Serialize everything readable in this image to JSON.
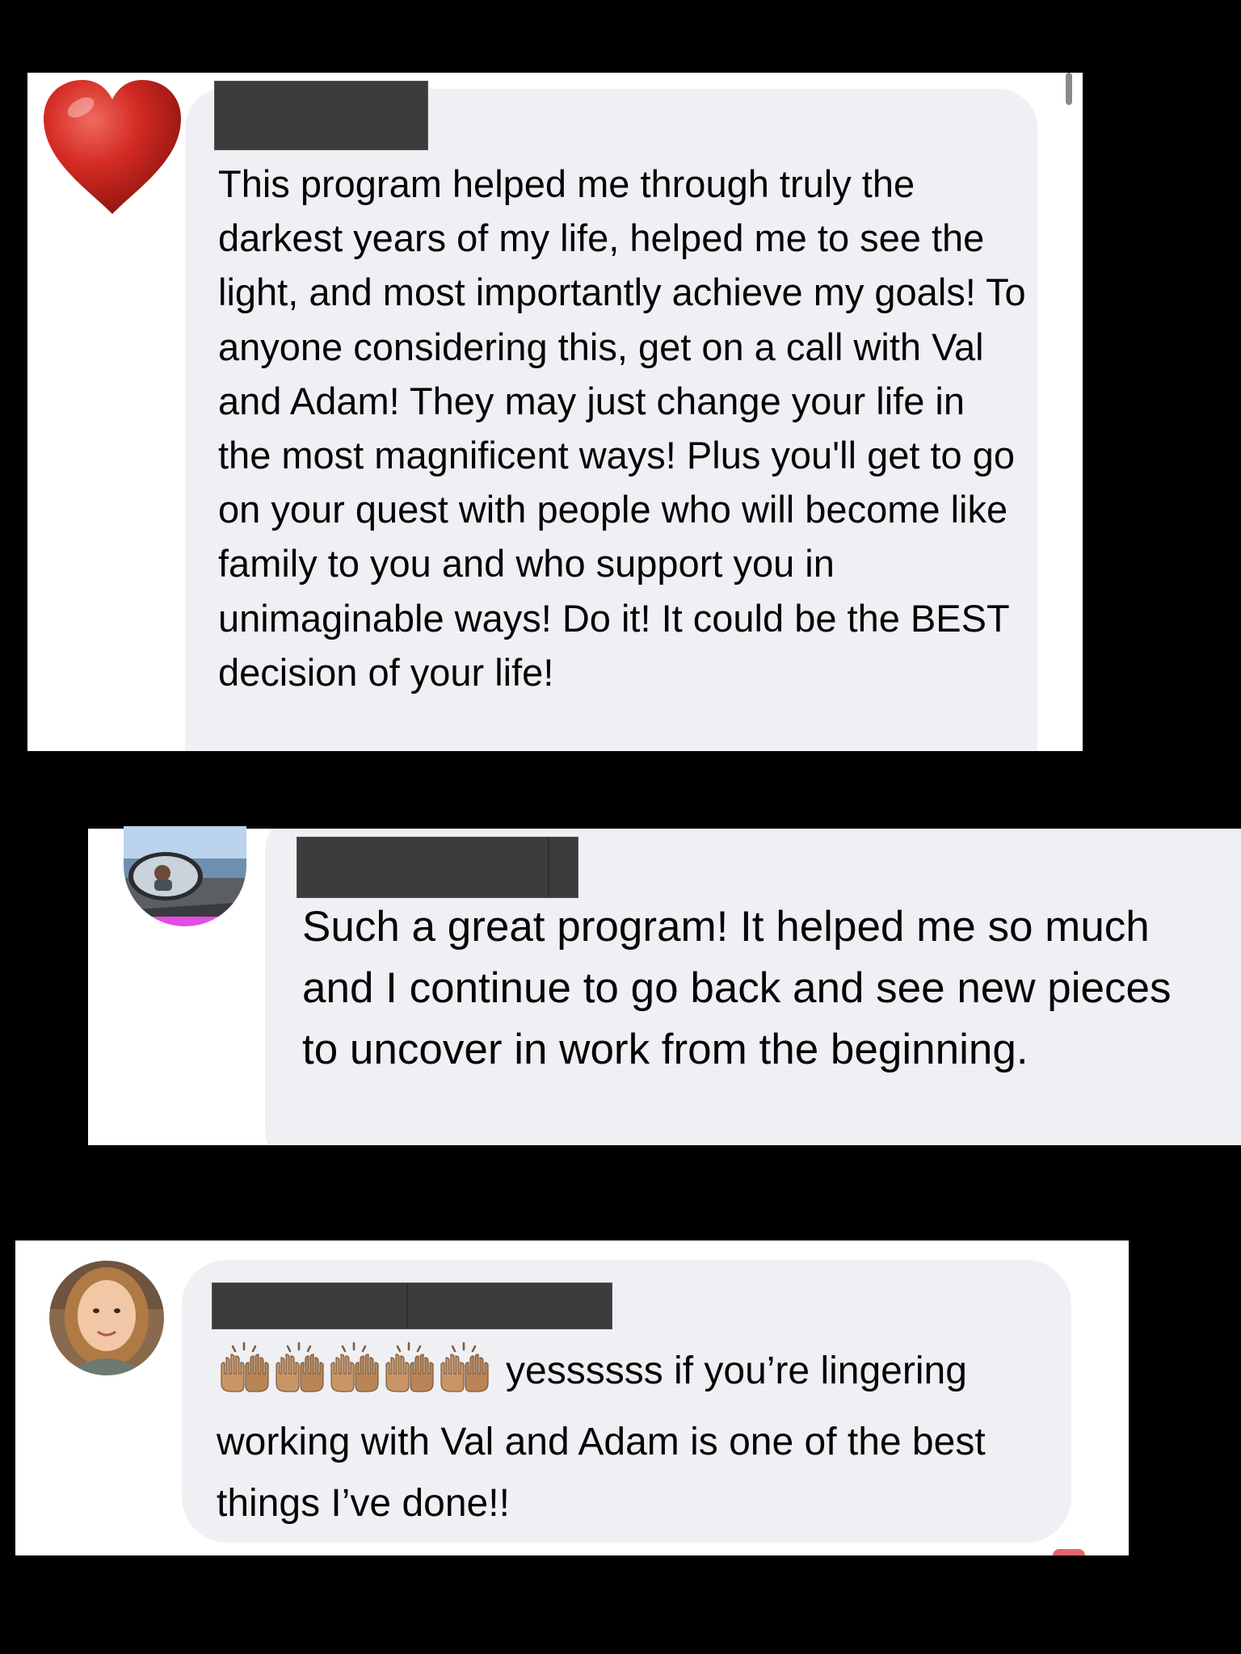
{
  "comments": [
    {
      "name": "",
      "avatar": "red-heart-emoji-avatar",
      "text": "This program helped me through truly the darkest years of my life, helped me to see the light, and most importantly achieve my goals! To anyone considering this, get on a call with Val and Adam! They may just change your life in the most magnificent ways! Plus you'll get to go on your quest with people who will become like family to you and who support you in unimaginable ways! Do it! It could be the BEST decision of your life!"
    },
    {
      "name": "",
      "avatar": "car-mirror-selfie-avatar",
      "text": "Such a great program! It helped me so much and I continue to go back and see new pieces to uncover in work from the beginning."
    },
    {
      "name": "",
      "avatar": "woman-portrait-avatar",
      "emoji": "clapping-hands-icon",
      "emoji_count": 5,
      "text": "yessssss if you’re lingering working with Val and Adam is one of the best things I’ve done!!"
    }
  ],
  "colors": {
    "background": "#000000",
    "card": "#ffffff",
    "bubble": "#eff0f3",
    "redaction": "#3c3c3c",
    "text": "#050505"
  }
}
